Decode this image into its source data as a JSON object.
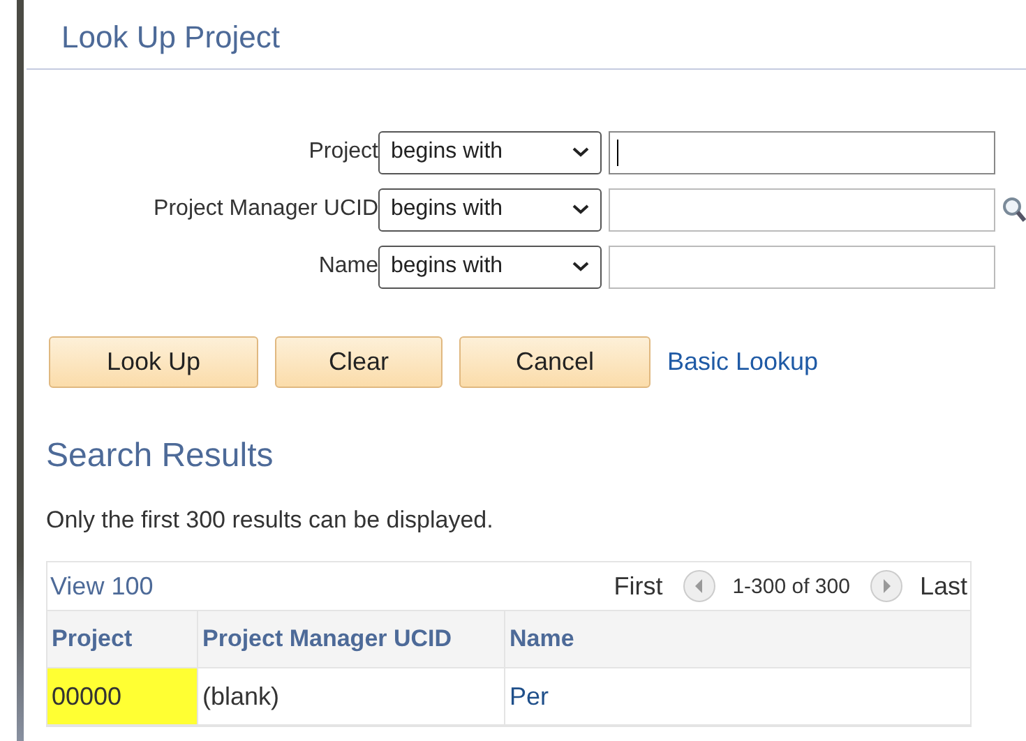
{
  "page_title": "Look Up Project",
  "criteria": [
    {
      "label": "Project",
      "operator": "begins with",
      "focused": true,
      "lookup_icon": false
    },
    {
      "label": "Project Manager UCID",
      "operator": "begins with",
      "focused": false,
      "lookup_icon": true
    },
    {
      "label": "Name",
      "operator": "begins with",
      "focused": false,
      "lookup_icon": false
    }
  ],
  "buttons": [
    "Look Up",
    "Clear",
    "Cancel"
  ],
  "basic_lookup_link": "Basic Lookup",
  "results_heading": "Search Results",
  "results_note": "Only the first 300 results can be displayed.",
  "grid": {
    "view_link": "View 100",
    "first": "First",
    "range": "1-300 of 300",
    "last": "Last",
    "columns": [
      "Project",
      "Project Manager UCID",
      "Name"
    ],
    "rows": [
      {
        "cells": [
          "00000",
          "(blank)",
          "Per"
        ],
        "highlighted": true
      }
    ]
  }
}
